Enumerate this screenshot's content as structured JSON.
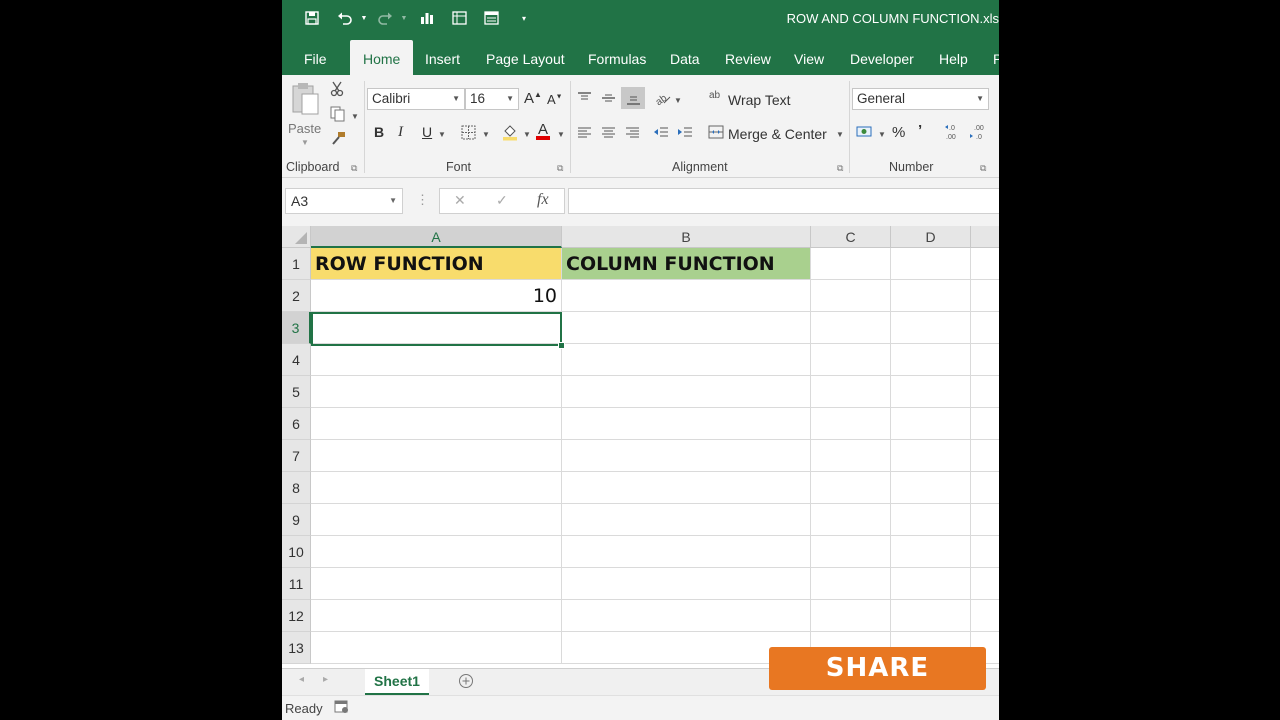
{
  "titlebar": {
    "title": "ROW AND COLUMN FUNCTION.xls"
  },
  "tabs": [
    {
      "label": "File"
    },
    {
      "label": "Home"
    },
    {
      "label": "Insert"
    },
    {
      "label": "Page Layout"
    },
    {
      "label": "Formulas"
    },
    {
      "label": "Data"
    },
    {
      "label": "Review"
    },
    {
      "label": "View"
    },
    {
      "label": "Developer"
    },
    {
      "label": "Help"
    },
    {
      "label": "P"
    }
  ],
  "ribbon": {
    "clipboard": {
      "paste_label": "Paste",
      "group_label": "Clipboard"
    },
    "font": {
      "font_name": "Calibri",
      "font_size": "16",
      "bold": "B",
      "italic": "I",
      "underline": "U",
      "group_label": "Font"
    },
    "alignment": {
      "wrap_text": "Wrap Text",
      "merge_center": "Merge & Center",
      "group_label": "Alignment"
    },
    "number": {
      "format": "General",
      "percent": "%",
      "comma": "’",
      "group_label": "Number"
    }
  },
  "formula_bar": {
    "name_box": "A3",
    "cancel": "✕",
    "enter": "✓",
    "fx": "fx",
    "content": ""
  },
  "grid": {
    "columns": [
      "A",
      "B",
      "C",
      "D"
    ],
    "rows": [
      "1",
      "2",
      "3",
      "4",
      "5",
      "6",
      "7",
      "8",
      "9",
      "10",
      "11",
      "12",
      "13"
    ],
    "cells": {
      "A1": "ROW FUNCTION",
      "B1": "COLUMN FUNCTION",
      "A2": "10"
    },
    "colors": {
      "A1_fill": "#f8dc6c",
      "B1_fill": "#a9d08e",
      "accent": "#217346"
    }
  },
  "sheets": [
    {
      "label": "Sheet1"
    }
  ],
  "status": {
    "text": "Ready"
  },
  "share": {
    "label": "SHARE"
  }
}
